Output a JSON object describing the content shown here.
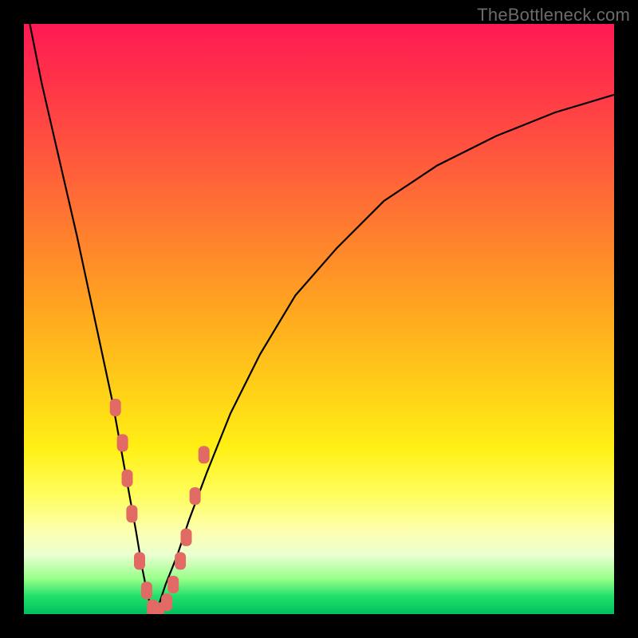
{
  "watermark": "TheBottleneck.com",
  "colors": {
    "frame": "#000000",
    "marker": "#e16a64",
    "curve": "#000000",
    "gradient_top": "#ff1a54",
    "gradient_bottom": "#00c060"
  },
  "chart_data": {
    "type": "line",
    "title": "",
    "xlabel": "",
    "ylabel": "",
    "xlim": [
      0,
      100
    ],
    "ylim": [
      0,
      100
    ],
    "grid": false,
    "legend": false,
    "note": "V-shaped bottleneck curve; y≈100 is worst (red), y≈0 is best (green). Minimum near x≈22, y≈0.",
    "series": [
      {
        "name": "bottleneck-curve",
        "x": [
          1,
          3,
          6,
          9,
          12,
          15,
          17,
          19,
          20,
          21,
          22,
          23,
          24,
          26,
          28,
          31,
          35,
          40,
          46,
          53,
          61,
          70,
          80,
          90,
          100
        ],
        "y": [
          100,
          90,
          77,
          64,
          50,
          36,
          25,
          14,
          8,
          3,
          0,
          2,
          5,
          10,
          16,
          24,
          34,
          44,
          54,
          62,
          70,
          76,
          81,
          85,
          88
        ]
      }
    ],
    "markers": {
      "name": "highlighted-points",
      "shape": "rounded-rect",
      "x": [
        15.5,
        16.7,
        17.5,
        18.3,
        19.6,
        20.8,
        21.8,
        22.8,
        24.2,
        25.3,
        26.5,
        27.5,
        29.0,
        30.5
      ],
      "y": [
        35,
        29,
        23,
        17,
        9,
        4,
        1,
        0.5,
        2,
        5,
        9,
        13,
        20,
        27
      ]
    }
  }
}
